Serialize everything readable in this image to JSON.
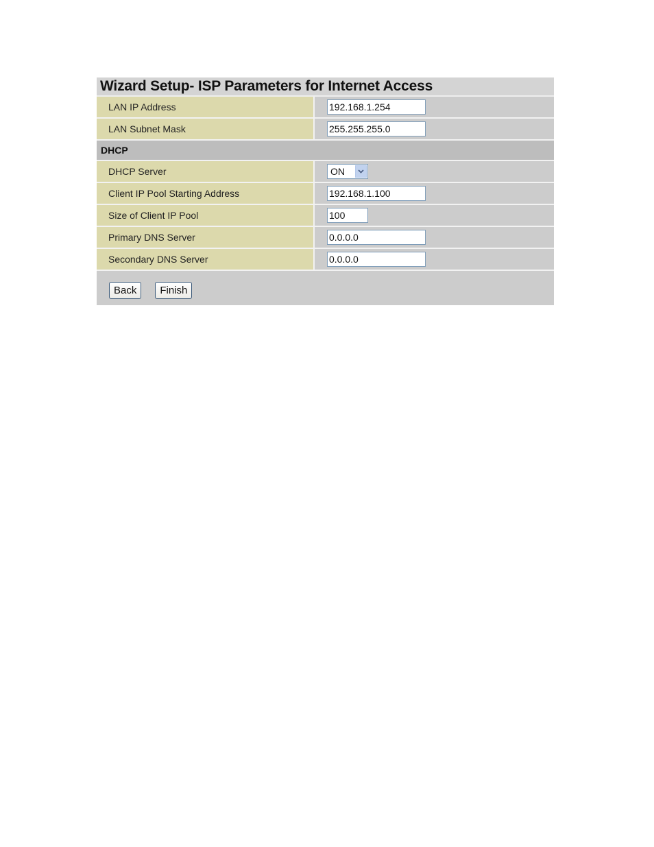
{
  "page": {
    "title": "Wizard Setup- ISP Parameters for Internet Access"
  },
  "lan": {
    "ip_address": {
      "label": "LAN IP Address",
      "value": "192.168.1.254"
    },
    "subnet_mask": {
      "label": "LAN Subnet Mask",
      "value": "255.255.255.0"
    }
  },
  "dhcp": {
    "section_label": "DHCP",
    "server": {
      "label": "DHCP Server",
      "value": "ON",
      "icon": "chevron-down-icon"
    },
    "pool_start": {
      "label": "Client IP Pool Starting Address",
      "value": "192.168.1.100"
    },
    "pool_size": {
      "label": "Size of Client IP Pool",
      "value": "100"
    },
    "primary_dns": {
      "label": "Primary DNS Server",
      "value": "0.0.0.0"
    },
    "secondary_dns": {
      "label": "Secondary DNS Server",
      "value": "0.0.0.0"
    }
  },
  "buttons": {
    "back": "Back",
    "finish": "Finish"
  },
  "colors": {
    "label_bg": "#dcd9ac",
    "value_bg": "#cccccc",
    "section_bg": "#bdbdbd"
  }
}
